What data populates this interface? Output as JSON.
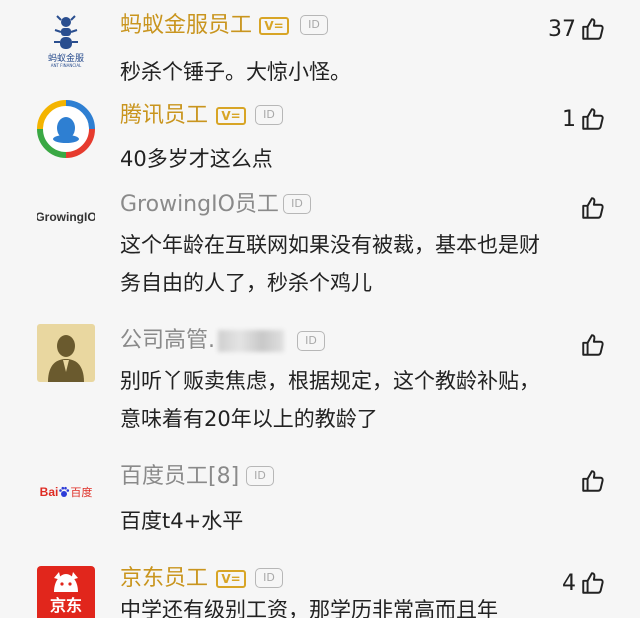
{
  "colors": {
    "vip_username": "#c9951e",
    "normal_username": "#8a8a8a",
    "badge_gold": "#d8a526"
  },
  "comments": [
    {
      "username": "蚂蚁金服员工",
      "verified_badge": "V=",
      "id_badge": "ID",
      "text": "秒杀个锤子。大惊小怪。",
      "likes": "37",
      "avatar": {
        "logo_text": "蚂蚁金服",
        "sub_text": "ANT FINANCIAL",
        "icon": "ant-logo-icon"
      }
    },
    {
      "username": "腾讯员工",
      "verified_badge": "V=",
      "id_badge": "ID",
      "text": "40多岁才这么点",
      "likes": "1",
      "avatar": {
        "icon": "tencent-logo-icon"
      }
    },
    {
      "username": "GrowingIO员工",
      "id_badge": "ID",
      "text": "这个年龄在互联网如果没有被裁，基本也是财务自由的人了，秒杀个鸡儿",
      "likes": "",
      "avatar": {
        "logo_text": "GrowingIO",
        "icon": "growingio-logo-icon"
      }
    },
    {
      "username": "公司高管.",
      "id_badge": "ID",
      "text": "别听丫贩卖焦虑，根据规定，这个教龄补贴，意味着有20年以上的教龄了",
      "likes": "",
      "avatar": {
        "icon": "executive-avatar-icon"
      }
    },
    {
      "username": "百度员工[8]",
      "id_badge": "ID",
      "text": "百度t4+水平",
      "likes": "",
      "avatar": {
        "logo_text_left": "Bai",
        "logo_text_right": "百度",
        "icon": "baidu-paw-icon"
      }
    },
    {
      "username": "京东员工",
      "verified_badge": "V=",
      "id_badge": "ID",
      "text": "中学还有级别工资，那学历非常高而且年",
      "likes": "4",
      "avatar": {
        "logo_text": "京东",
        "icon": "jd-dog-logo-icon"
      }
    }
  ]
}
